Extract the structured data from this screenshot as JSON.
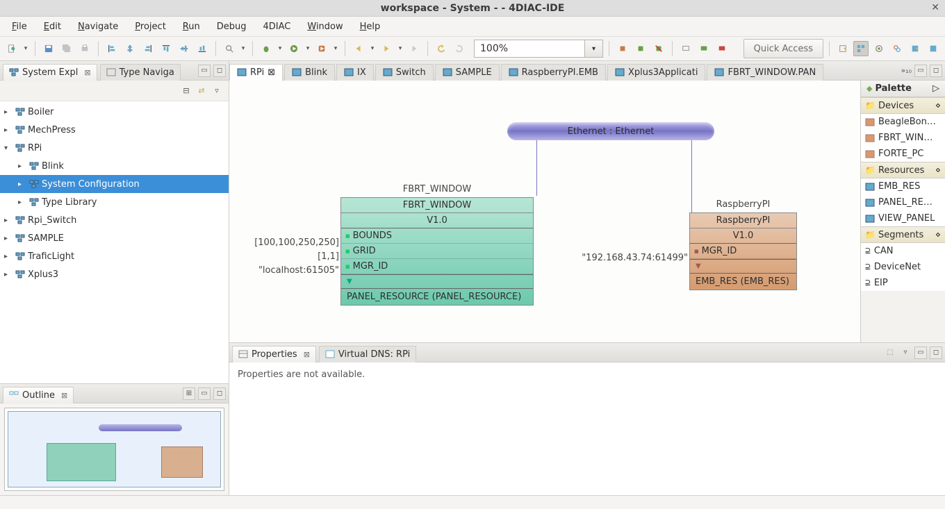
{
  "window": {
    "title": "workspace - System -  - 4DIAC-IDE"
  },
  "menu": {
    "items": [
      "File",
      "Edit",
      "Navigate",
      "Project",
      "Run",
      "Debug",
      "4DIAC",
      "Window",
      "Help"
    ]
  },
  "toolbar": {
    "zoom": "100%",
    "quick_access": "Quick Access"
  },
  "left_tabs": {
    "system_explorer": "System Expl",
    "type_nav": "Type Naviga"
  },
  "tree": {
    "items": [
      {
        "label": "Boiler",
        "depth": 0,
        "expanded": false,
        "icon": "system"
      },
      {
        "label": "MechPress",
        "depth": 0,
        "expanded": false,
        "icon": "system"
      },
      {
        "label": "RPi",
        "depth": 0,
        "expanded": true,
        "icon": "system"
      },
      {
        "label": "Blink",
        "depth": 1,
        "expanded": false,
        "icon": "app"
      },
      {
        "label": "System Configuration",
        "depth": 1,
        "expanded": false,
        "icon": "sysconf",
        "selected": true
      },
      {
        "label": "Type Library",
        "depth": 1,
        "expanded": false,
        "icon": "typelib"
      },
      {
        "label": "Rpi_Switch",
        "depth": 0,
        "expanded": false,
        "icon": "system"
      },
      {
        "label": "SAMPLE",
        "depth": 0,
        "expanded": false,
        "icon": "system"
      },
      {
        "label": "TraficLight",
        "depth": 0,
        "expanded": false,
        "icon": "system"
      },
      {
        "label": "Xplus3",
        "depth": 0,
        "expanded": false,
        "icon": "system"
      }
    ]
  },
  "outline": {
    "title": "Outline"
  },
  "editor_tabs": [
    "RPi",
    "Blink",
    "IX",
    "Switch",
    "SAMPLE",
    "RaspberryPI.EMB",
    "Xplus3Applicati",
    "FBRT_WINDOW.PAN"
  ],
  "editor_tabs_overflow": "»₁₀",
  "diagram": {
    "ethernet": "Ethernet : Ethernet",
    "dev1": {
      "top_name": "FBRT_WINDOW",
      "title": "FBRT_WINDOW",
      "version": "V1.0",
      "ports": [
        "BOUNDS",
        "GRID",
        "MGR_ID"
      ],
      "port_values": [
        "[100,100,250,250]",
        "[1,1]",
        "\"localhost:61505\""
      ],
      "resource": "PANEL_RESOURCE (PANEL_RESOURCE)"
    },
    "dev2": {
      "top_name": "RaspberryPI",
      "title": "RaspberryPI",
      "version": "V1.0",
      "ports": [
        "MGR_ID"
      ],
      "port_values": [
        "\"192.168.43.74:61499\""
      ],
      "resource": "EMB_RES (EMB_RES)"
    }
  },
  "palette": {
    "title": "Palette",
    "drawers": {
      "devices": {
        "label": "Devices",
        "items": [
          "BeagleBon…",
          "FBRT_WIN…",
          "FORTE_PC"
        ]
      },
      "resources": {
        "label": "Resources",
        "items": [
          "EMB_RES",
          "PANEL_RE…",
          "VIEW_PANEL"
        ]
      },
      "segments": {
        "label": "Segments",
        "items": [
          "CAN",
          "DeviceNet",
          "EIP"
        ]
      }
    }
  },
  "bottom": {
    "properties_tab": "Properties",
    "vdns_tab": "Virtual DNS: RPi",
    "props_msg": "Properties are not available."
  }
}
